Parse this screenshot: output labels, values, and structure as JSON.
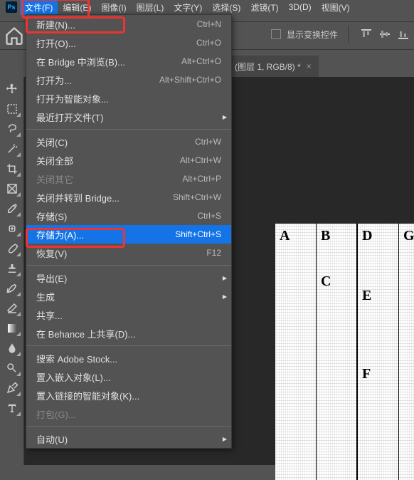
{
  "app": {
    "logo": "Ps"
  },
  "menubar": [
    {
      "label": "文件(F)",
      "active": true
    },
    {
      "label": "编辑(E)"
    },
    {
      "label": "图像(I)"
    },
    {
      "label": "图层(L)"
    },
    {
      "label": "文字(Y)"
    },
    {
      "label": "选择(S)"
    },
    {
      "label": "滤镜(T)"
    },
    {
      "label": "3D(D)"
    },
    {
      "label": "视图(V)"
    }
  ],
  "options": {
    "show_transform_controls": "显示变换控件"
  },
  "doc_tab": {
    "title": "(图层 1, RGB/8) *"
  },
  "file_menu": [
    {
      "label": "新建(N)...",
      "shortcut": "Ctrl+N"
    },
    {
      "label": "打开(O)...",
      "shortcut": "Ctrl+O"
    },
    {
      "label": "在 Bridge 中浏览(B)...",
      "shortcut": "Alt+Ctrl+O"
    },
    {
      "label": "打开为...",
      "shortcut": "Alt+Shift+Ctrl+O"
    },
    {
      "label": "打开为智能对象..."
    },
    {
      "label": "最近打开文件(T)",
      "submenu": true
    },
    {
      "sep": true
    },
    {
      "label": "关闭(C)",
      "shortcut": "Ctrl+W"
    },
    {
      "label": "关闭全部",
      "shortcut": "Alt+Ctrl+W"
    },
    {
      "label": "关闭其它",
      "shortcut": "Alt+Ctrl+P",
      "disabled": true
    },
    {
      "label": "关闭并转到 Bridge...",
      "shortcut": "Shift+Ctrl+W"
    },
    {
      "label": "存储(S)",
      "shortcut": "Ctrl+S"
    },
    {
      "label": "存储为(A)...",
      "shortcut": "Shift+Ctrl+S",
      "selected": true
    },
    {
      "label": "恢复(V)",
      "shortcut": "F12"
    },
    {
      "sep": true
    },
    {
      "label": "导出(E)",
      "submenu": true
    },
    {
      "label": "生成",
      "submenu": true
    },
    {
      "label": "共享..."
    },
    {
      "label": "在 Behance 上共享(D)..."
    },
    {
      "sep": true
    },
    {
      "label": "搜索 Adobe Stock..."
    },
    {
      "label": "置入嵌入对象(L)..."
    },
    {
      "label": "置入链接的智能对象(K)..."
    },
    {
      "label": "打包(G)...",
      "disabled": true
    },
    {
      "sep": true
    },
    {
      "label": "自动(U)",
      "submenu": true
    }
  ],
  "canvas": {
    "letters": [
      "A",
      "B",
      "C",
      "D",
      "E",
      "F",
      "G"
    ]
  }
}
